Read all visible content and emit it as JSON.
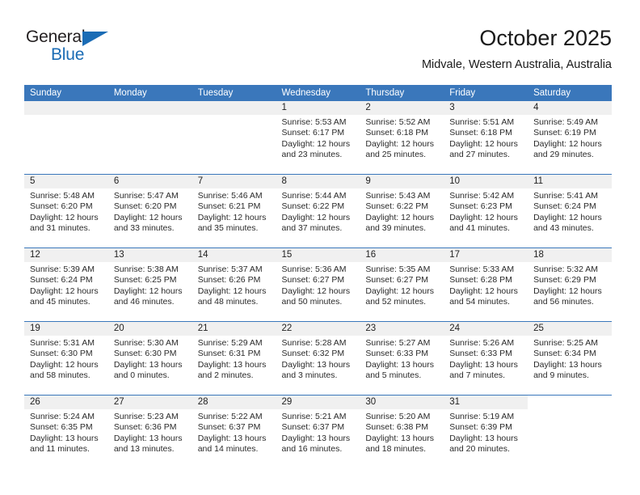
{
  "logo": {
    "word1": "General",
    "word2": "Blue",
    "triangle_color": "#1b6cb5"
  },
  "header": {
    "title": "October 2025",
    "subtitle": "Midvale, Western Australia, Australia"
  },
  "theme": {
    "header_blue": "#3a77bb",
    "daynum_gray": "#f0f0f0",
    "text": "#222222"
  },
  "weekdays": [
    "Sunday",
    "Monday",
    "Tuesday",
    "Wednesday",
    "Thursday",
    "Friday",
    "Saturday"
  ],
  "labels": {
    "sunrise_prefix": "Sunrise:",
    "sunset_prefix": "Sunset:",
    "daylight_prefix": "Daylight:"
  },
  "weeks": [
    [
      {
        "day": "",
        "empty": true
      },
      {
        "day": "",
        "empty": true
      },
      {
        "day": "",
        "empty": true
      },
      {
        "day": "1",
        "sunrise": "Sunrise: 5:53 AM",
        "sunset": "Sunset: 6:17 PM",
        "daylight_l1": "Daylight: 12 hours",
        "daylight_l2": "and 23 minutes."
      },
      {
        "day": "2",
        "sunrise": "Sunrise: 5:52 AM",
        "sunset": "Sunset: 6:18 PM",
        "daylight_l1": "Daylight: 12 hours",
        "daylight_l2": "and 25 minutes."
      },
      {
        "day": "3",
        "sunrise": "Sunrise: 5:51 AM",
        "sunset": "Sunset: 6:18 PM",
        "daylight_l1": "Daylight: 12 hours",
        "daylight_l2": "and 27 minutes."
      },
      {
        "day": "4",
        "sunrise": "Sunrise: 5:49 AM",
        "sunset": "Sunset: 6:19 PM",
        "daylight_l1": "Daylight: 12 hours",
        "daylight_l2": "and 29 minutes."
      }
    ],
    [
      {
        "day": "5",
        "sunrise": "Sunrise: 5:48 AM",
        "sunset": "Sunset: 6:20 PM",
        "daylight_l1": "Daylight: 12 hours",
        "daylight_l2": "and 31 minutes."
      },
      {
        "day": "6",
        "sunrise": "Sunrise: 5:47 AM",
        "sunset": "Sunset: 6:20 PM",
        "daylight_l1": "Daylight: 12 hours",
        "daylight_l2": "and 33 minutes."
      },
      {
        "day": "7",
        "sunrise": "Sunrise: 5:46 AM",
        "sunset": "Sunset: 6:21 PM",
        "daylight_l1": "Daylight: 12 hours",
        "daylight_l2": "and 35 minutes."
      },
      {
        "day": "8",
        "sunrise": "Sunrise: 5:44 AM",
        "sunset": "Sunset: 6:22 PM",
        "daylight_l1": "Daylight: 12 hours",
        "daylight_l2": "and 37 minutes."
      },
      {
        "day": "9",
        "sunrise": "Sunrise: 5:43 AM",
        "sunset": "Sunset: 6:22 PM",
        "daylight_l1": "Daylight: 12 hours",
        "daylight_l2": "and 39 minutes."
      },
      {
        "day": "10",
        "sunrise": "Sunrise: 5:42 AM",
        "sunset": "Sunset: 6:23 PM",
        "daylight_l1": "Daylight: 12 hours",
        "daylight_l2": "and 41 minutes."
      },
      {
        "day": "11",
        "sunrise": "Sunrise: 5:41 AM",
        "sunset": "Sunset: 6:24 PM",
        "daylight_l1": "Daylight: 12 hours",
        "daylight_l2": "and 43 minutes."
      }
    ],
    [
      {
        "day": "12",
        "sunrise": "Sunrise: 5:39 AM",
        "sunset": "Sunset: 6:24 PM",
        "daylight_l1": "Daylight: 12 hours",
        "daylight_l2": "and 45 minutes."
      },
      {
        "day": "13",
        "sunrise": "Sunrise: 5:38 AM",
        "sunset": "Sunset: 6:25 PM",
        "daylight_l1": "Daylight: 12 hours",
        "daylight_l2": "and 46 minutes."
      },
      {
        "day": "14",
        "sunrise": "Sunrise: 5:37 AM",
        "sunset": "Sunset: 6:26 PM",
        "daylight_l1": "Daylight: 12 hours",
        "daylight_l2": "and 48 minutes."
      },
      {
        "day": "15",
        "sunrise": "Sunrise: 5:36 AM",
        "sunset": "Sunset: 6:27 PM",
        "daylight_l1": "Daylight: 12 hours",
        "daylight_l2": "and 50 minutes."
      },
      {
        "day": "16",
        "sunrise": "Sunrise: 5:35 AM",
        "sunset": "Sunset: 6:27 PM",
        "daylight_l1": "Daylight: 12 hours",
        "daylight_l2": "and 52 minutes."
      },
      {
        "day": "17",
        "sunrise": "Sunrise: 5:33 AM",
        "sunset": "Sunset: 6:28 PM",
        "daylight_l1": "Daylight: 12 hours",
        "daylight_l2": "and 54 minutes."
      },
      {
        "day": "18",
        "sunrise": "Sunrise: 5:32 AM",
        "sunset": "Sunset: 6:29 PM",
        "daylight_l1": "Daylight: 12 hours",
        "daylight_l2": "and 56 minutes."
      }
    ],
    [
      {
        "day": "19",
        "sunrise": "Sunrise: 5:31 AM",
        "sunset": "Sunset: 6:30 PM",
        "daylight_l1": "Daylight: 12 hours",
        "daylight_l2": "and 58 minutes."
      },
      {
        "day": "20",
        "sunrise": "Sunrise: 5:30 AM",
        "sunset": "Sunset: 6:30 PM",
        "daylight_l1": "Daylight: 13 hours",
        "daylight_l2": "and 0 minutes."
      },
      {
        "day": "21",
        "sunrise": "Sunrise: 5:29 AM",
        "sunset": "Sunset: 6:31 PM",
        "daylight_l1": "Daylight: 13 hours",
        "daylight_l2": "and 2 minutes."
      },
      {
        "day": "22",
        "sunrise": "Sunrise: 5:28 AM",
        "sunset": "Sunset: 6:32 PM",
        "daylight_l1": "Daylight: 13 hours",
        "daylight_l2": "and 3 minutes."
      },
      {
        "day": "23",
        "sunrise": "Sunrise: 5:27 AM",
        "sunset": "Sunset: 6:33 PM",
        "daylight_l1": "Daylight: 13 hours",
        "daylight_l2": "and 5 minutes."
      },
      {
        "day": "24",
        "sunrise": "Sunrise: 5:26 AM",
        "sunset": "Sunset: 6:33 PM",
        "daylight_l1": "Daylight: 13 hours",
        "daylight_l2": "and 7 minutes."
      },
      {
        "day": "25",
        "sunrise": "Sunrise: 5:25 AM",
        "sunset": "Sunset: 6:34 PM",
        "daylight_l1": "Daylight: 13 hours",
        "daylight_l2": "and 9 minutes."
      }
    ],
    [
      {
        "day": "26",
        "sunrise": "Sunrise: 5:24 AM",
        "sunset": "Sunset: 6:35 PM",
        "daylight_l1": "Daylight: 13 hours",
        "daylight_l2": "and 11 minutes."
      },
      {
        "day": "27",
        "sunrise": "Sunrise: 5:23 AM",
        "sunset": "Sunset: 6:36 PM",
        "daylight_l1": "Daylight: 13 hours",
        "daylight_l2": "and 13 minutes."
      },
      {
        "day": "28",
        "sunrise": "Sunrise: 5:22 AM",
        "sunset": "Sunset: 6:37 PM",
        "daylight_l1": "Daylight: 13 hours",
        "daylight_l2": "and 14 minutes."
      },
      {
        "day": "29",
        "sunrise": "Sunrise: 5:21 AM",
        "sunset": "Sunset: 6:37 PM",
        "daylight_l1": "Daylight: 13 hours",
        "daylight_l2": "and 16 minutes."
      },
      {
        "day": "30",
        "sunrise": "Sunrise: 5:20 AM",
        "sunset": "Sunset: 6:38 PM",
        "daylight_l1": "Daylight: 13 hours",
        "daylight_l2": "and 18 minutes."
      },
      {
        "day": "31",
        "sunrise": "Sunrise: 5:19 AM",
        "sunset": "Sunset: 6:39 PM",
        "daylight_l1": "Daylight: 13 hours",
        "daylight_l2": "and 20 minutes."
      },
      {
        "day": "",
        "void": true
      }
    ]
  ]
}
